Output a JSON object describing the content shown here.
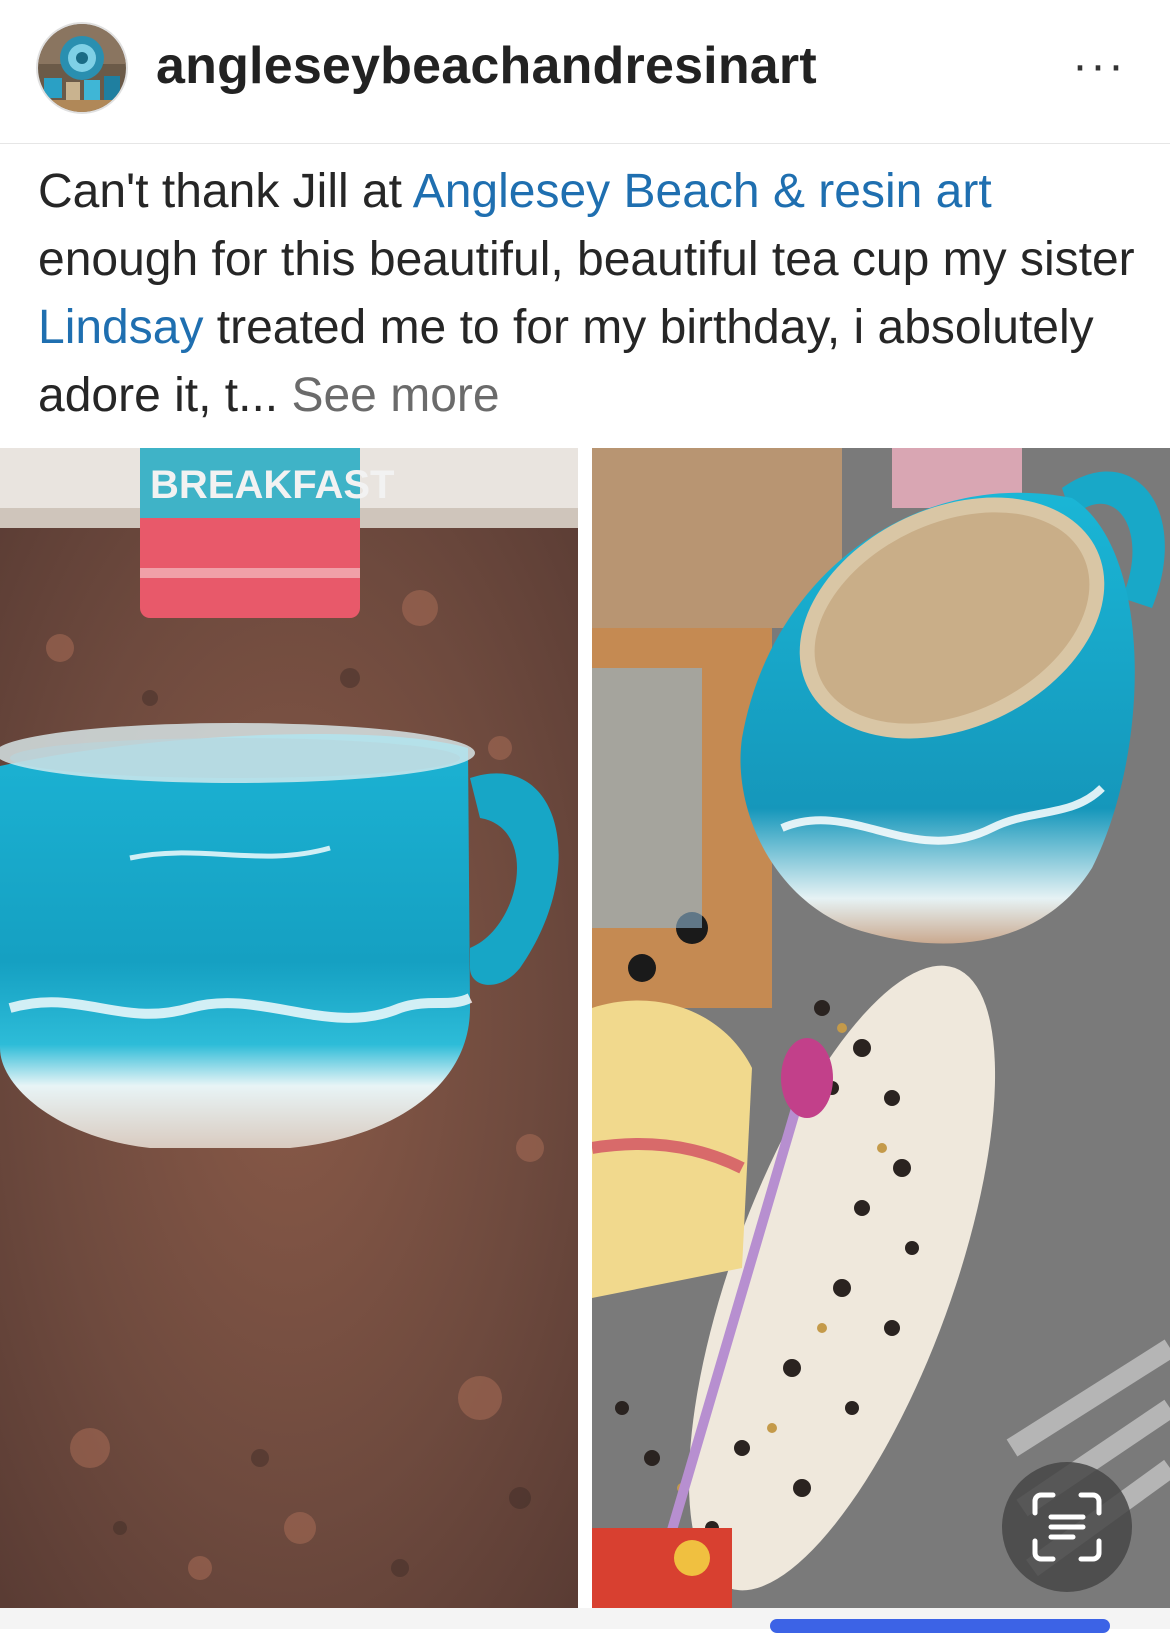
{
  "header": {
    "username": "angleseybeachandresinart",
    "more_label": "···",
    "avatar_icon": "profile-avatar-icon"
  },
  "post": {
    "text_1": "Can't thank Jill at ",
    "link_business": "Anglesey Beach & resin art",
    "text_2": " enough for this beautiful, beautiful tea cup my sister ",
    "link_person": "Lindsay",
    "text_3": " treated me to for my birthday, i absolutely adore it, t...",
    "see_more": "See more"
  },
  "photos": {
    "left_label_text": "BREAKFAST",
    "lens_icon": "visual-search-icon"
  },
  "colors": {
    "link": "#1f6fb0",
    "text": "#262626",
    "resin_blue": "#18a7c7",
    "lens_bg": "#464646"
  }
}
